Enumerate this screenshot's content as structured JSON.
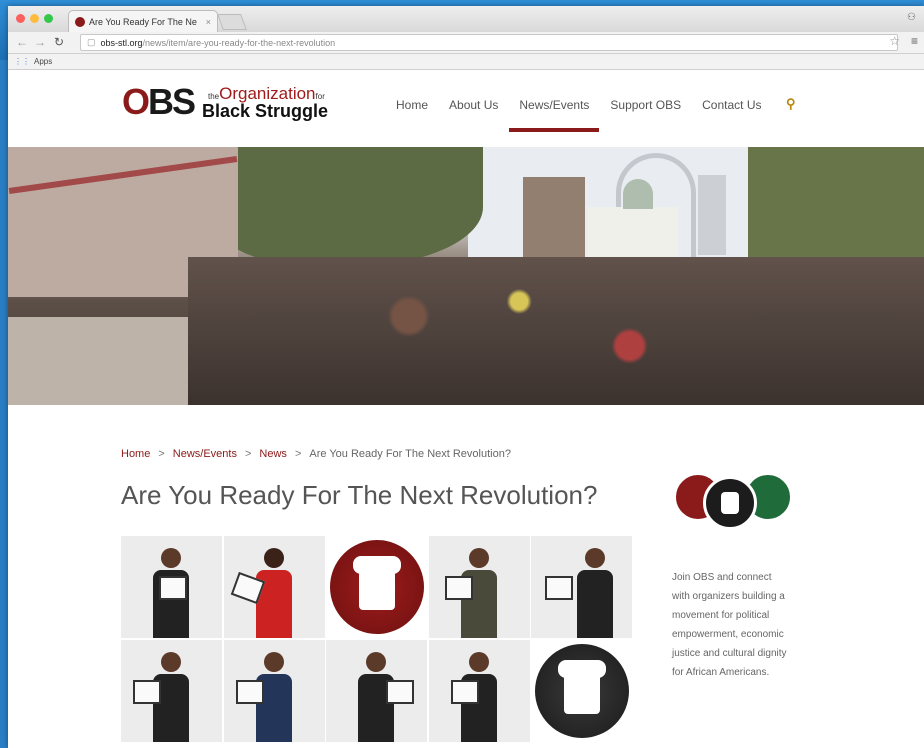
{
  "browser": {
    "tab_title": "Are You Ready For The Ne",
    "tab_close": "×",
    "url_domain": "obs-stl.org",
    "url_path": "/news/item/are-you-ready-for-the-next-revolution",
    "bookmarks_label": "Apps"
  },
  "site": {
    "logo_obs": "OBS",
    "logo_the": "the",
    "logo_org": "Organization",
    "logo_for": "for",
    "logo_bs": "Black Struggle",
    "nav": [
      "Home",
      "About Us",
      "News/Events",
      "Support OBS",
      "Contact Us"
    ],
    "active_nav": "News/Events"
  },
  "breadcrumb": {
    "items": [
      "Home",
      "News/Events",
      "News"
    ],
    "separator": ">",
    "current": "Are You Ready For The Next Revolution?"
  },
  "article": {
    "title": "Are You Ready For The Next Revolution?"
  },
  "sidebar": {
    "text": "Join OBS and connect with organizers building a movement for political empowerment, economic justice and cultural dignity for African Americans."
  },
  "colors": {
    "brand_red": "#8b1a1a",
    "brand_green": "#1f6b3a",
    "brand_black": "#1c1c1c"
  }
}
